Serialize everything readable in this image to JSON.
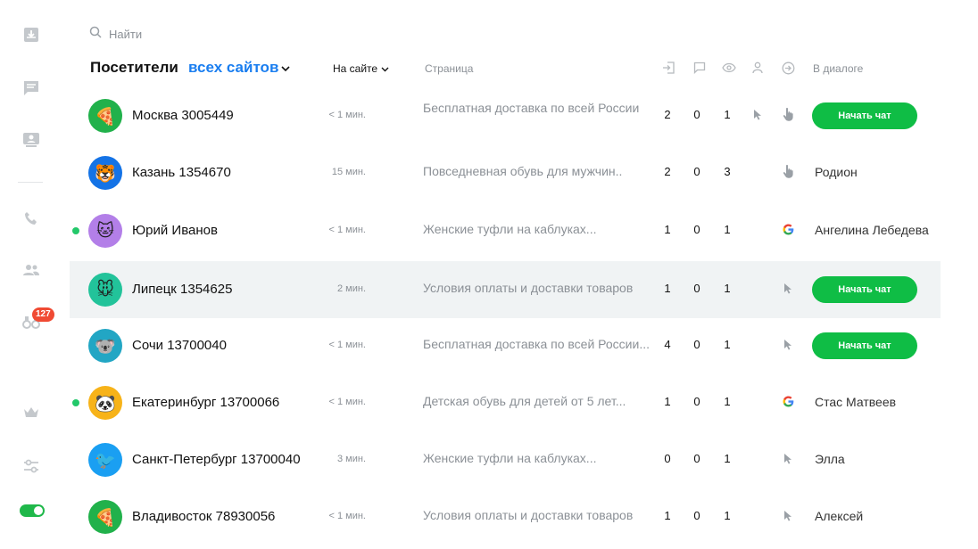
{
  "sidebar": {
    "items": [
      {
        "name": "inbox-icon"
      },
      {
        "name": "chat-icon"
      },
      {
        "name": "visitors-icon"
      },
      {
        "name": "phone-icon"
      },
      {
        "name": "team-icon"
      },
      {
        "name": "binoculars-icon"
      },
      {
        "name": "crown-icon"
      },
      {
        "name": "settings-sliders-icon"
      }
    ],
    "badge_count": "127",
    "toggle_on": true
  },
  "search": {
    "placeholder": "Найти"
  },
  "header": {
    "title": "Посетители",
    "scope_link": "всех сайтов",
    "filter_label": "На сайте",
    "col_page": "Страница",
    "col_dialog": "В диалоге",
    "stat_icons": [
      "enter-icon",
      "message-icon",
      "eye-icon",
      "person-icon",
      "arrow-circle-icon"
    ]
  },
  "colors": {
    "accent_blue": "#1a7ef0",
    "button_green": "#0fbd45",
    "online_green": "#23c86a",
    "badge_red": "#f04a33",
    "selected_row": "#f0f3f4"
  },
  "visitors": [
    {
      "name": "Москва 3005449",
      "time": "< 1 мин.",
      "page": "Бесплатная доставка по всей России",
      "visits": "2",
      "chats": "0",
      "views": "1",
      "online": false,
      "avatar_icon": "pizza-icon",
      "avatar_glyph": "🍕",
      "avatar_color": "#21b14b",
      "source": "cursor-icon",
      "extra": "hand-icon",
      "dialog_type": "button",
      "dialog": "Начать чат"
    },
    {
      "name": "Казань 1354670",
      "time": "15 мин.",
      "page": "Повседневная обувь для мужчин..",
      "visits": "2",
      "chats": "0",
      "views": "3",
      "online": false,
      "avatar_icon": "tiger-icon",
      "avatar_glyph": "🐯",
      "avatar_color": "#1473e6",
      "source": "",
      "extra": "hand-icon",
      "dialog_type": "text",
      "dialog": "Родион"
    },
    {
      "name": "Юрий Иванов",
      "time": "< 1 мин.",
      "page": "Женские туфли на каблуках...",
      "visits": "1",
      "chats": "0",
      "views": "1",
      "online": true,
      "avatar_icon": "cat-icon",
      "avatar_glyph": "🐱",
      "avatar_color": "#b37fe8",
      "source": "",
      "extra": "google-icon",
      "dialog_type": "text",
      "dialog": "Ангелина Лебедева"
    },
    {
      "name": "Липецк 1354625",
      "time": "2 мин.",
      "page": "Условия оплаты и доставки товаров",
      "visits": "1",
      "chats": "0",
      "views": "1",
      "online": false,
      "selected": true,
      "avatar_icon": "mouse-icon",
      "avatar_glyph": "🐭",
      "avatar_color": "#22c39a",
      "source": "",
      "extra": "cursor-icon",
      "dialog_type": "button",
      "dialog": "Начать чат"
    },
    {
      "name": "Сочи 13700040",
      "time": "< 1 мин.",
      "page": "Бесплатная доставка по всей России...",
      "visits": "4",
      "chats": "0",
      "views": "1",
      "online": false,
      "avatar_icon": "koala-icon",
      "avatar_glyph": "🐨",
      "avatar_color": "#22a6c4",
      "source": "",
      "extra": "cursor-icon",
      "dialog_type": "button",
      "dialog": "Начать чат"
    },
    {
      "name": "Екатеринбург 13700066",
      "time": "< 1 мин.",
      "page": "Детская обувь для детей от 5 лет...",
      "visits": "1",
      "chats": "0",
      "views": "1",
      "online": true,
      "avatar_icon": "panda-icon",
      "avatar_glyph": "🐼",
      "avatar_color": "#f7b319",
      "source": "",
      "extra": "google-icon",
      "dialog_type": "text",
      "dialog": "Стас Матвеев"
    },
    {
      "name": "Санкт-Петербург 13700040",
      "time": "3 мин.",
      "page": "Женские туфли на каблуках...",
      "visits": "0",
      "chats": "0",
      "views": "1",
      "online": false,
      "avatar_icon": "bird-icon",
      "avatar_glyph": "🐦",
      "avatar_color": "#1a9ff2",
      "source": "",
      "extra": "cursor-icon",
      "dialog_type": "text",
      "dialog": "Элла"
    },
    {
      "name": "Владивосток 78930056",
      "time": "< 1 мин.",
      "page": "Условия оплаты и доставки товаров",
      "visits": "1",
      "chats": "0",
      "views": "1",
      "online": false,
      "avatar_icon": "pizza-icon",
      "avatar_glyph": "🍕",
      "avatar_color": "#21b14b",
      "source": "",
      "extra": "cursor-icon",
      "dialog_type": "text",
      "dialog": "Алексей"
    }
  ]
}
